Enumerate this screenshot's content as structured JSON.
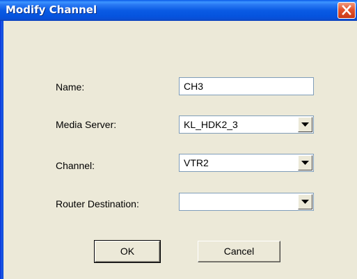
{
  "window": {
    "title": "Modify Channel"
  },
  "form": {
    "name_label": "Name:",
    "name_value": "CH3",
    "media_server_label": "Media Server:",
    "media_server_value": "KL_HDK2_3",
    "channel_label": "Channel:",
    "channel_value": "VTR2",
    "router_destination_label": "Router Destination:",
    "router_destination_value": ""
  },
  "buttons": {
    "ok_label": "OK",
    "cancel_label": "Cancel"
  },
  "icons": {
    "close": "close-icon",
    "dropdown": "chevron-down-icon"
  },
  "colors": {
    "titlebar": "#0a5be4",
    "client": "#ece9d8",
    "close_button": "#e3522c"
  }
}
